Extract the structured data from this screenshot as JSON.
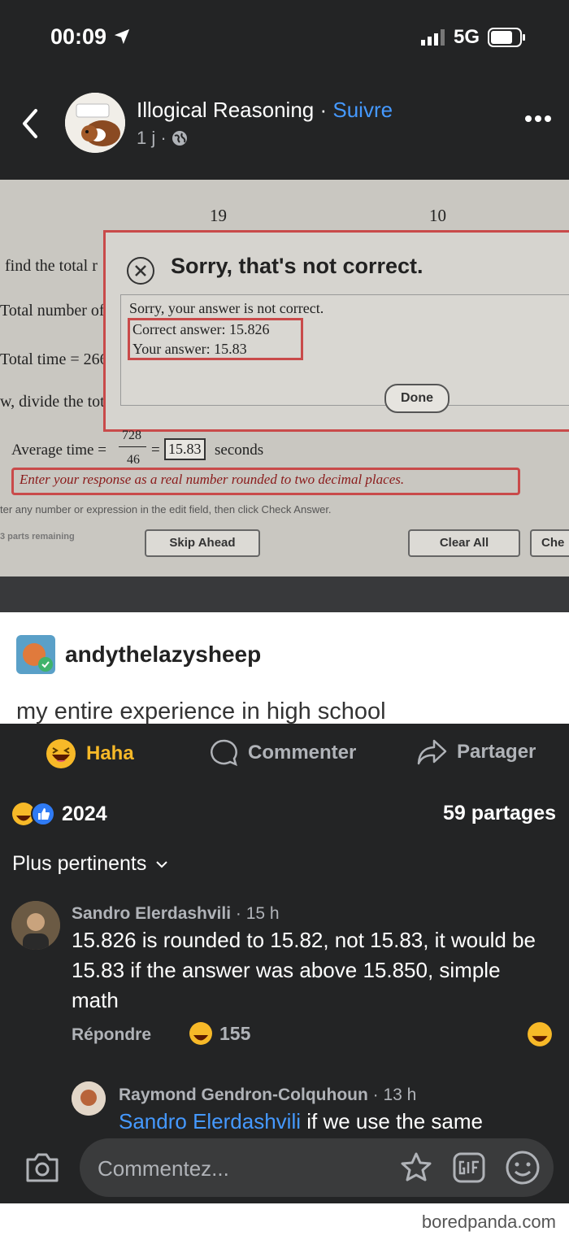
{
  "status_bar": {
    "time": "00:09",
    "network": "5G"
  },
  "header": {
    "page_name": "Illogical Reasoning",
    "separator": " · ",
    "follow_label": "Suivre",
    "timestamp": "1 j ·"
  },
  "photo": {
    "top_left_number": "19",
    "top_right_number": "10",
    "left_lines": [
      "find the total r",
      "Total number of",
      "Total time = 266",
      "w, divide the tota"
    ],
    "dialog": {
      "title": "Sorry, that's not correct.",
      "message": "Sorry, your answer is not correct.",
      "correct_answer": "Correct answer: 15.826",
      "your_answer": "Your answer: 15.83",
      "done_label": "Done"
    },
    "formula_prefix": "Average time =",
    "numerator": "728",
    "denominator": "46",
    "equals": "=",
    "answer_box": "15.83",
    "formula_suffix": "seconds",
    "instruction": "Enter your response as a real number rounded to two decimal places.",
    "hint": "ter any number or expression in the edit field, then click Check Answer.",
    "parts_remaining": "3 parts remaining",
    "skip_label": "Skip Ahead",
    "clear_label": "Clear All",
    "check_label": "Che"
  },
  "caption": {
    "username": "andythelazysheep",
    "text": "my entire experience in high school"
  },
  "actions": {
    "haha_label": "Haha",
    "comment_label": "Commenter",
    "share_label": "Partager",
    "haha_color": "#f7b928",
    "link_color": "#4599ff"
  },
  "stats": {
    "reactions": "2024",
    "shares": "59 partages"
  },
  "filter_label": "Plus pertinents",
  "comments": [
    {
      "author": "Sandro Elerdashvili",
      "time": " · 15 h",
      "text": "15.826 is rounded to 15.82, not 15.83, it would be 15.83 if the answer was above 15.850, simple math",
      "reply_label": "Répondre",
      "reaction_count": "155"
    },
    {
      "author": "Raymond Gendron-Colquhoun",
      "time": " · 13 h",
      "mention": "Sandro Elerdashvili",
      "text": " if we use the same"
    }
  ],
  "comment_input": {
    "placeholder": "Commentez..."
  },
  "icons": [
    "back-arrow-icon",
    "location-arrow-icon",
    "signal-icon",
    "battery-icon",
    "globe-icon",
    "more-icon",
    "haha-emoji-icon",
    "comment-bubble-icon",
    "share-arrow-icon",
    "like-icon",
    "chevron-down-icon",
    "camera-icon",
    "sticker-icon",
    "gif-icon",
    "smiley-icon"
  ],
  "watermark": "boredpanda.com"
}
